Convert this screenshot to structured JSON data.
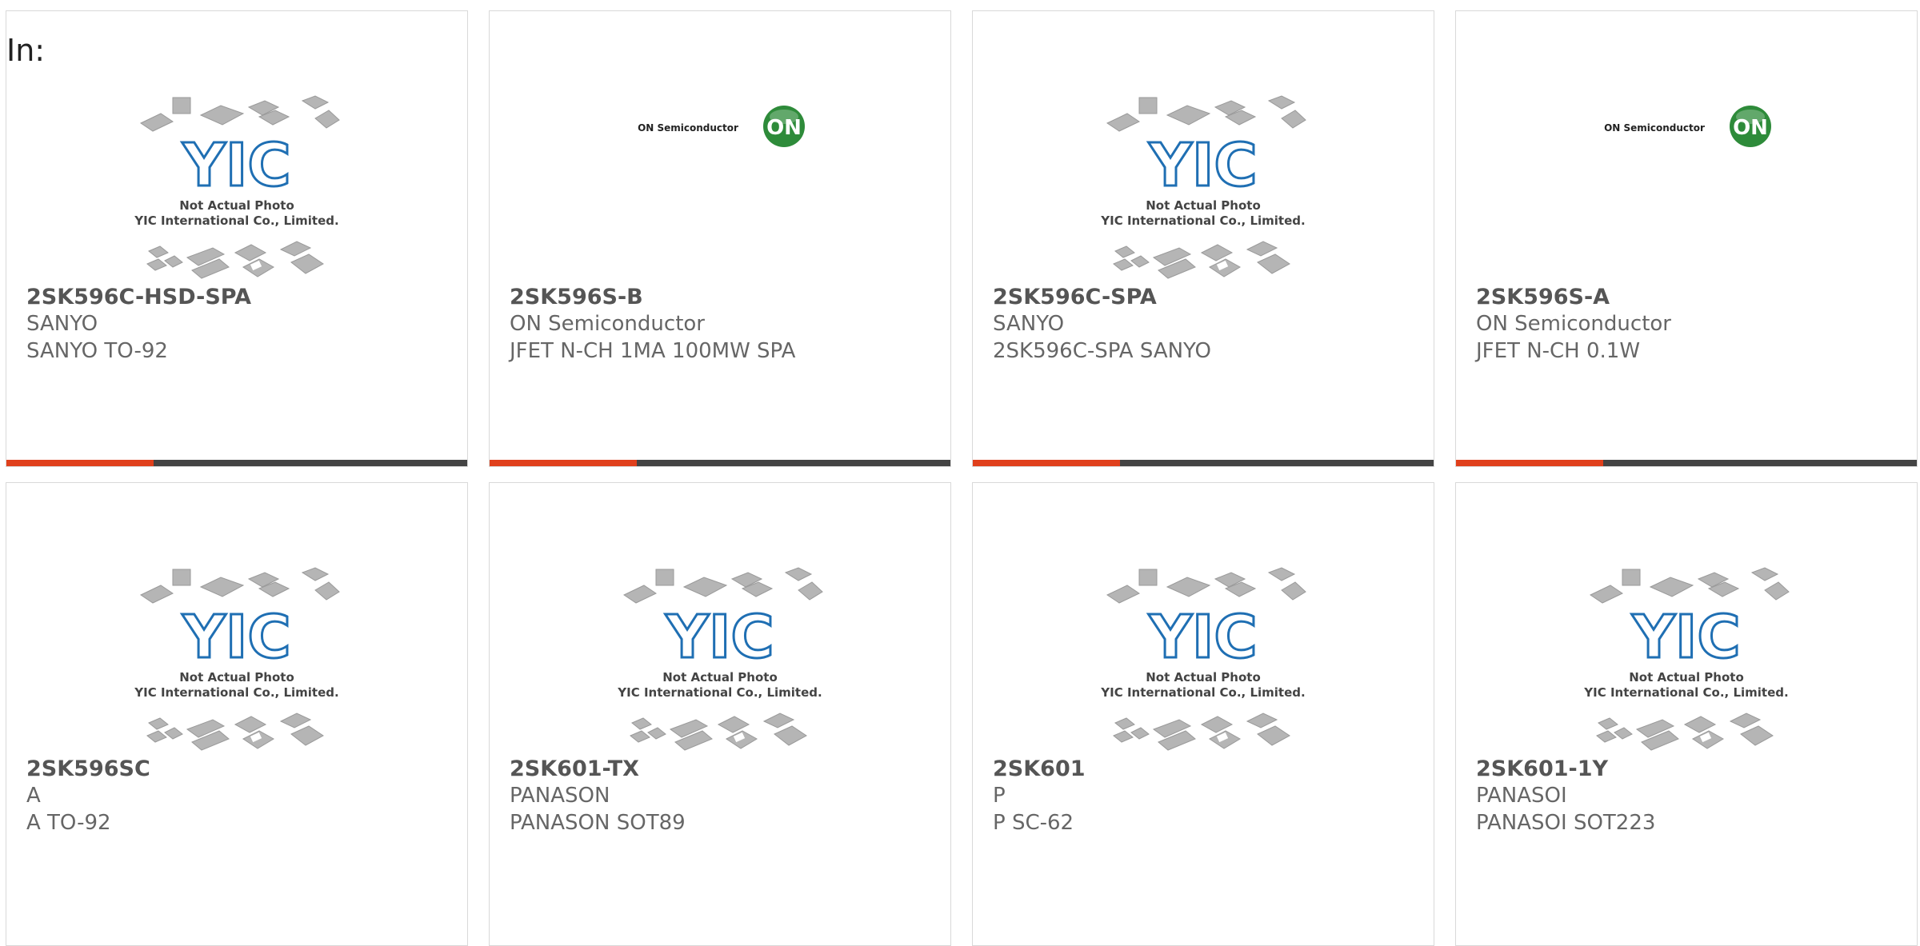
{
  "header": {
    "in_label": "In:"
  },
  "colors": {
    "accent": "#e0401c",
    "bar": "#444444",
    "yic_blue": "#1f6fb3",
    "on_green": "#2e8b3a"
  },
  "placeholder_image": {
    "line1": "Not Actual Photo",
    "line2": "YIC International Co., Limited.",
    "logo_text": "YIC"
  },
  "on_logo": {
    "name": "ON Semiconductor",
    "badge": "ON"
  },
  "products": [
    {
      "part": "2SK596C-HSD-SPA",
      "manufacturer": "SANYO",
      "description": "SANYO TO-92",
      "image": "yic-placeholder",
      "progress": 0.32
    },
    {
      "part": "2SK596S-B",
      "manufacturer": "ON Semiconductor",
      "description": "JFET N-CH 1MA 100MW SPA",
      "image": "on-logo",
      "progress": 0.32
    },
    {
      "part": "2SK596C-SPA",
      "manufacturer": "SANYO",
      "description": "2SK596C-SPA SANYO",
      "image": "yic-placeholder",
      "progress": 0.32
    },
    {
      "part": "2SK596S-A",
      "manufacturer": "ON Semiconductor",
      "description": "JFET N-CH 0.1W",
      "image": "on-logo",
      "progress": 0.32
    },
    {
      "part": "2SK596SC",
      "manufacturer": "A",
      "description": "A TO-92",
      "image": "yic-placeholder"
    },
    {
      "part": "2SK601-TX",
      "manufacturer": "PANASON",
      "description": "PANASON SOT89",
      "image": "yic-placeholder"
    },
    {
      "part": "2SK601",
      "manufacturer": "P",
      "description": "P SC-62",
      "image": "yic-placeholder"
    },
    {
      "part": "2SK601-1Y",
      "manufacturer": "PANASOI",
      "description": "PANASOI SOT223",
      "image": "yic-placeholder"
    }
  ]
}
